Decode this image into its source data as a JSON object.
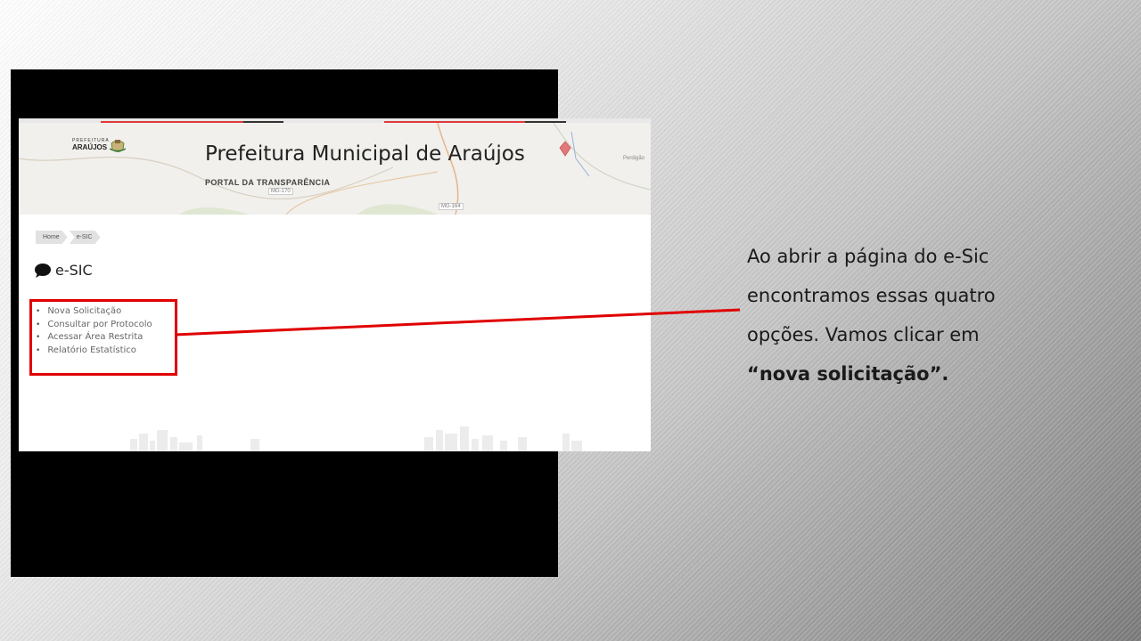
{
  "site": {
    "logo_small": "PREFEITURA",
    "logo_big": "ARAÚJOS",
    "title": "Prefeitura Municipal de Araújos",
    "subtitle": "PORTAL DA TRANSPARÊNCIA"
  },
  "map": {
    "road_1": "MG-170",
    "road_2": "MG-164",
    "place": "Perdigão"
  },
  "breadcrumb": [
    "Home",
    "e-SIC"
  ],
  "page_heading": "e-SIC",
  "options": [
    "Nova Solicitação",
    "Consultar por Protocolo",
    "Acessar Área Restrita",
    "Relatório Estatístico"
  ],
  "caption": {
    "line1": "Ao abrir a página do e-Sic",
    "line2": "encontramos essas quatro",
    "line3": "opções. Vamos clicar em",
    "quote_open": "“",
    "highlight": "nova solicitação",
    "quote_close": "”."
  },
  "colors": {
    "highlight_red": "#e00000",
    "stripe_red": "#e03a3a"
  }
}
